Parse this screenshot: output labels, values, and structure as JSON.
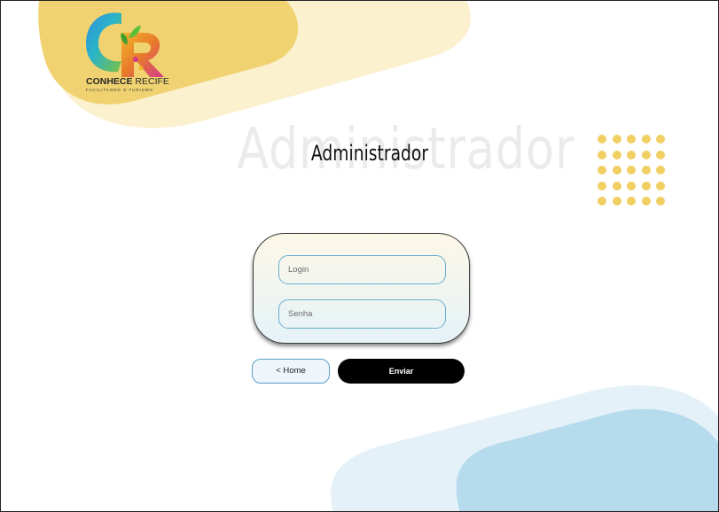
{
  "brand": {
    "name_bold": "CONHECE",
    "name_light": " RECIFE",
    "tagline": "FACILITANDO O TURISMO",
    "logo_letters": "CR"
  },
  "header": {
    "background_title": "Administrador",
    "title": "Administrador"
  },
  "form": {
    "login_placeholder": "Login",
    "login_value": "",
    "password_placeholder": "Senha",
    "password_value": ""
  },
  "actions": {
    "home_label": "< Home",
    "submit_label": "Enviar"
  },
  "colors": {
    "yellow_accent": "#f0cf63",
    "yellow_light": "#faf0cc",
    "blue_light": "#e3f1f8",
    "blue_accent": "#b3daeb",
    "field_border": "#6aaecd",
    "submit_bg": "#000000"
  },
  "icons": {
    "logo": "conhece-recife-logo-icon",
    "dot_grid": "dot-grid-decoration"
  }
}
